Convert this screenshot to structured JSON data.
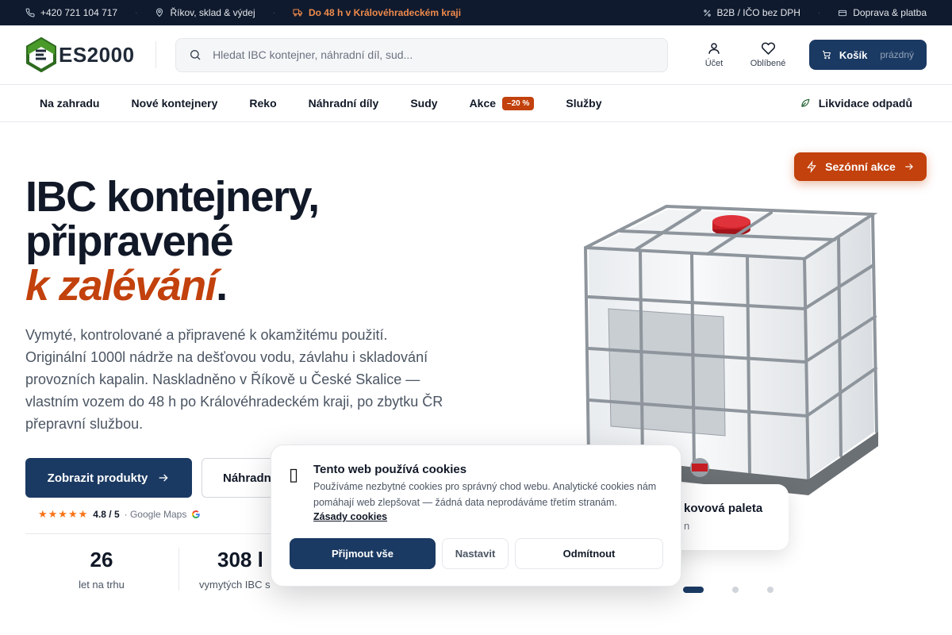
{
  "topbar": {
    "phone": "+420 721 104 717",
    "location": "Říkov, sklad & výdej",
    "delivery": "Do 48 h v Královéhradeckém kraji",
    "b2b": "B2B / IČO bez DPH",
    "shipping": "Doprava & platba"
  },
  "header": {
    "logo_text": "ES2000",
    "search_placeholder": "Hledat IBC kontejner, náhradní díl, sud...",
    "account": "Účet",
    "favorites": "Oblíbené",
    "cart_label": "Košík",
    "cart_status": "prázdný"
  },
  "nav": {
    "items": [
      "Na zahradu",
      "Nové kontejnery",
      "Reko",
      "Náhradní díly",
      "Sudy",
      "Akce",
      "Služby"
    ],
    "sale_badge": "–20 %",
    "waste": "Likvidace odpadů"
  },
  "hero": {
    "title_line1": "IBC kontejnery,",
    "title_line2": "připravené",
    "title_accent": "k zalévání",
    "title_dot": ".",
    "lead": "Vymyté, kontrolované a připravené k okamžitému použití. Originální 1000l nádrže na dešťovou vodu, závlahu i skladování provozních kapalin. Naskladněno v Říkově u České Skalice — vlastním vozem do 48 h po Královéhradeckém kraji, po zbytku ČR přepravní službou.",
    "primary_cta": "Zobrazit produkty",
    "secondary_cta": "Náhradní",
    "rating_value": "4.8 / 5",
    "rating_source": "· Google Maps",
    "rating_stars": 4.5,
    "seasonal_label": "Sezónní akce",
    "pallet_title": "kovová paleta",
    "pallet_sub": "n"
  },
  "stats": [
    {
      "value": "26",
      "label": "let na trhu"
    },
    {
      "value": "308 l",
      "label": "vymytých IBC s"
    }
  ],
  "carousel": {
    "slides": 3,
    "active": 1
  },
  "cookie": {
    "icon": "cookie-icon",
    "title": "Tento web používá cookies",
    "text": "Používáme nezbytné cookies pro správný chod webu. Analytické cookies nám pomáhají web zlepšovat — žádná data neprodáváme třetím stranám.",
    "link": "Zásady cookies",
    "accept": "Přijmout vše",
    "settings": "Nastavit",
    "reject": "Odmítnout"
  },
  "colors": {
    "navy": "#1b3a63",
    "accent": "#c2410c",
    "topbar": "#0f1a2e"
  }
}
